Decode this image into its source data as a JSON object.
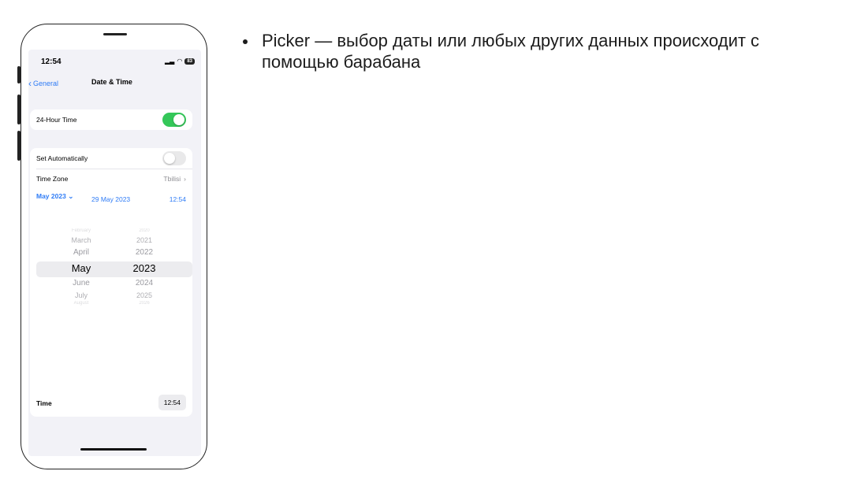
{
  "slide": {
    "bullet_text": "Picker — выбор даты или любых других данных происходит с помощью барабана"
  },
  "status_bar": {
    "time": "12:54",
    "battery": "83"
  },
  "nav": {
    "back_label": "General",
    "title": "Date & Time"
  },
  "settings": {
    "hour24_label": "24-Hour Time",
    "hour24_on": true,
    "set_auto_label": "Set Automatically",
    "set_auto_on": false,
    "timezone_label": "Time Zone",
    "timezone_value": "Tbilisi",
    "date_value": "29 May 2023",
    "time_value": "12:54",
    "month_selector": "May 2023"
  },
  "picker": {
    "months": [
      "February",
      "March",
      "April",
      "May",
      "June",
      "July",
      "August"
    ],
    "years": [
      "2020",
      "2021",
      "2022",
      "2023",
      "2024",
      "2025",
      "2026"
    ],
    "selected_month": "May",
    "selected_year": "2023"
  },
  "time_section": {
    "label": "Time",
    "value": "12:54"
  },
  "colors": {
    "accent": "#2f7cf6",
    "toggle_on": "#34c759",
    "background": "#f2f2f7"
  }
}
